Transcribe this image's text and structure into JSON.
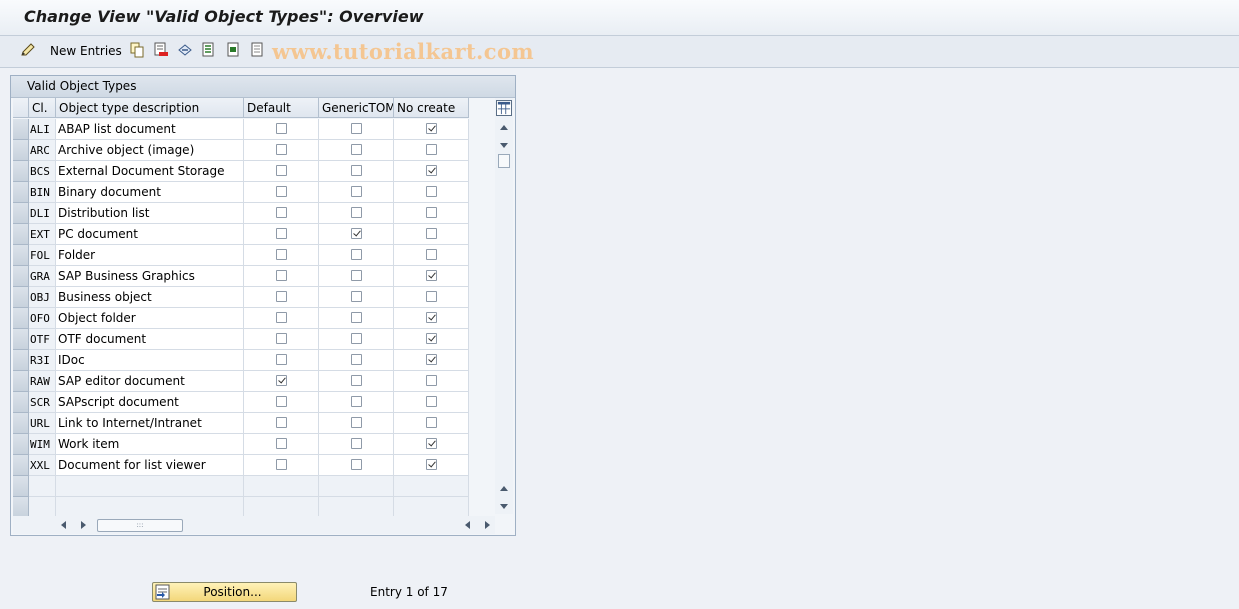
{
  "window": {
    "title": "Change View \"Valid Object Types\": Overview"
  },
  "toolbar": {
    "new_entries_label": "New Entries",
    "icons": [
      "edit-display-icon",
      "copy-icon",
      "delete-icon",
      "undo-icon",
      "select-all-icon",
      "select-block-icon",
      "deselect-all-icon"
    ],
    "watermark": "www.tutorialkart.com"
  },
  "table": {
    "title": "Valid Object Types",
    "columns": [
      "Cl.",
      "Object type description",
      "Default",
      "GenericTOM",
      "No create"
    ],
    "rows": [
      {
        "cl": "ALI",
        "desc": "ABAP list document",
        "default": false,
        "generic": false,
        "nocreate": true
      },
      {
        "cl": "ARC",
        "desc": "Archive object (image)",
        "default": false,
        "generic": false,
        "nocreate": false
      },
      {
        "cl": "BCS",
        "desc": "External Document Storage",
        "default": false,
        "generic": false,
        "nocreate": true
      },
      {
        "cl": "BIN",
        "desc": "Binary document",
        "default": false,
        "generic": false,
        "nocreate": false
      },
      {
        "cl": "DLI",
        "desc": "Distribution list",
        "default": false,
        "generic": false,
        "nocreate": false
      },
      {
        "cl": "EXT",
        "desc": "PC document",
        "default": false,
        "generic": true,
        "nocreate": false
      },
      {
        "cl": "FOL",
        "desc": "Folder",
        "default": false,
        "generic": false,
        "nocreate": false
      },
      {
        "cl": "GRA",
        "desc": "SAP Business Graphics",
        "default": false,
        "generic": false,
        "nocreate": true
      },
      {
        "cl": "OBJ",
        "desc": "Business object",
        "default": false,
        "generic": false,
        "nocreate": false
      },
      {
        "cl": "OFO",
        "desc": "Object folder",
        "default": false,
        "generic": false,
        "nocreate": true
      },
      {
        "cl": "OTF",
        "desc": "OTF document",
        "default": false,
        "generic": false,
        "nocreate": true
      },
      {
        "cl": "R3I",
        "desc": "IDoc",
        "default": false,
        "generic": false,
        "nocreate": true
      },
      {
        "cl": "RAW",
        "desc": "SAP editor document",
        "default": true,
        "generic": false,
        "nocreate": false
      },
      {
        "cl": "SCR",
        "desc": "SAPscript document",
        "default": false,
        "generic": false,
        "nocreate": false
      },
      {
        "cl": "URL",
        "desc": "Link to Internet/Intranet",
        "default": false,
        "generic": false,
        "nocreate": false
      },
      {
        "cl": "WIM",
        "desc": "Work item",
        "default": false,
        "generic": false,
        "nocreate": true
      },
      {
        "cl": "XXL",
        "desc": "Document for list viewer",
        "default": false,
        "generic": false,
        "nocreate": true
      }
    ],
    "empty_rows": 2
  },
  "footer": {
    "position_label": "Position...",
    "entry_info": "Entry 1 of 17"
  },
  "colors": {
    "background": "#eef1f6",
    "button_yellow": "#f3d77a",
    "watermark": "#f4c692"
  }
}
